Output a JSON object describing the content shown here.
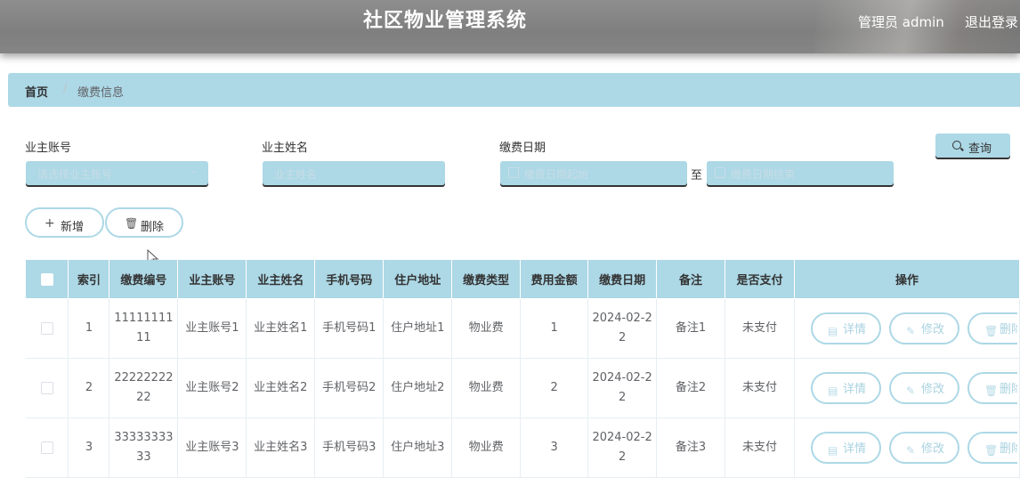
{
  "header": {
    "title": "社区物业管理系统",
    "user": "管理员 admin",
    "logout": "退出登录"
  },
  "breadcrumb": {
    "home": "首页",
    "separator": "/",
    "current": "缴费信息"
  },
  "search": {
    "account_label": "业主账号",
    "account_placeholder": "请选择业主账号",
    "name_label": "业主姓名",
    "name_placeholder": "业主姓名",
    "date_label": "缴费日期",
    "date_start_placeholder": "缴费日期起始",
    "date_to": "至",
    "date_end_placeholder": "缴费日期结束",
    "query_button": "查询"
  },
  "actions": {
    "add": "新增",
    "delete": "删除"
  },
  "table": {
    "columns": [
      "索引",
      "缴费编号",
      "业主账号",
      "业主姓名",
      "手机号码",
      "住户地址",
      "缴费类型",
      "费用金额",
      "缴费日期",
      "备注",
      "是否支付",
      "操作"
    ],
    "rows": [
      {
        "index": "1",
        "code": "1111111111",
        "account": "业主账号1",
        "name": "业主姓名1",
        "phone": "手机号码1",
        "address": "住户地址1",
        "type": "物业费",
        "amount": "1",
        "date": "2024-02-22",
        "note": "备注1",
        "paid": "未支付"
      },
      {
        "index": "2",
        "code": "2222222222",
        "account": "业主账号2",
        "name": "业主姓名2",
        "phone": "手机号码2",
        "address": "住户地址2",
        "type": "物业费",
        "amount": "2",
        "date": "2024-02-22",
        "note": "备注2",
        "paid": "未支付"
      },
      {
        "index": "3",
        "code": "3333333333",
        "account": "业主账号3",
        "name": "业主姓名3",
        "phone": "手机号码3",
        "address": "住户地址3",
        "type": "物业费",
        "amount": "3",
        "date": "2024-02-22",
        "note": "备注3",
        "paid": "未支付"
      }
    ],
    "row_actions": {
      "detail": "详情",
      "edit": "修改",
      "delete": "删除"
    }
  },
  "colors": {
    "accent": "#add8e6",
    "header_bg": "#8a8a8a"
  },
  "icons": {
    "query": "search-icon",
    "add": "plus-icon",
    "delete": "trash-icon",
    "detail": "document-icon",
    "edit": "pencil-icon"
  }
}
